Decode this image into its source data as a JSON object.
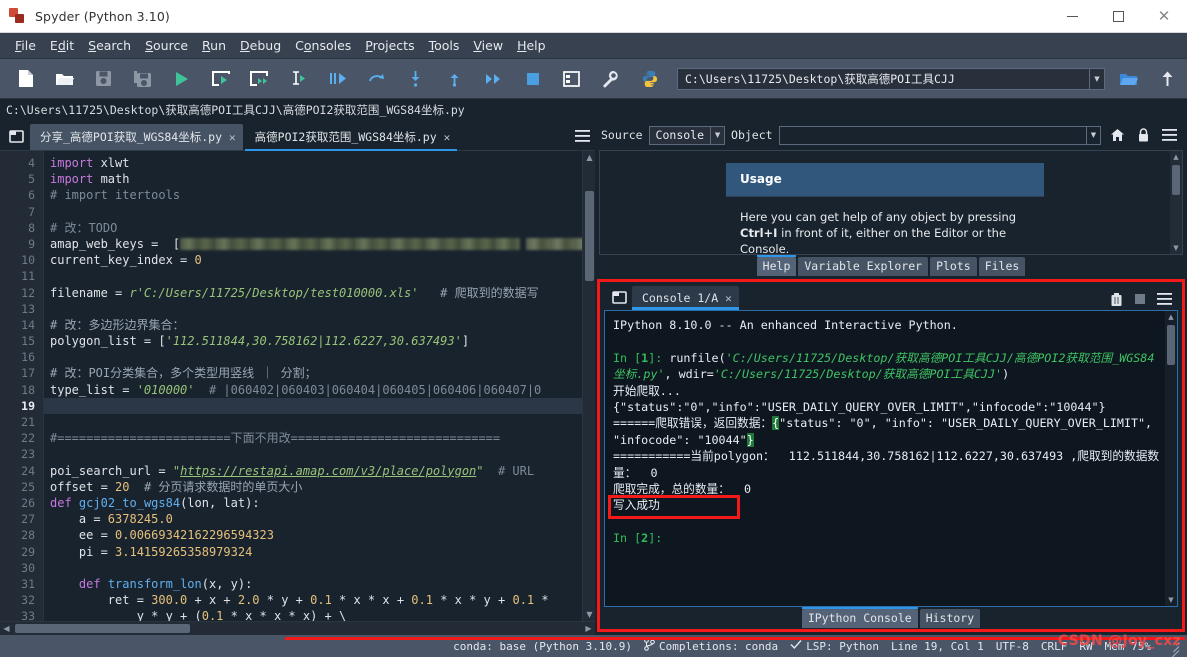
{
  "window": {
    "title": "Spyder (Python 3.10)",
    "minimize": "—",
    "maximize": "□",
    "close": "✕"
  },
  "menubar": {
    "items": [
      "File",
      "Edit",
      "Search",
      "Source",
      "Run",
      "Debug",
      "Consoles",
      "Projects",
      "Tools",
      "View",
      "Help"
    ]
  },
  "toolbar": {
    "icons": [
      "new-file-icon",
      "open-file-icon",
      "save-file-icon",
      "save-all-icon",
      "run-file-icon",
      "run-cell-icon",
      "run-cell-advance-icon",
      "run-selection-icon",
      "debug-file-icon",
      "step-over-icon",
      "step-into-icon",
      "step-return-icon",
      "continue-icon",
      "stop-debug-icon",
      "panes-layout-icon",
      "preferences-icon",
      "python-path-icon"
    ],
    "path_value": "C:\\Users\\11725\\Desktop\\获取高德POI工具CJJ",
    "browse_icon": "folder-open-icon",
    "parent_icon": "arrow-up-icon"
  },
  "editor": {
    "filepath": "C:\\Users\\11725\\Desktop\\获取高德POI工具CJJ\\高德POI2获取范围_WGS84坐标.py",
    "tabs": [
      {
        "label": "分享_高德POI获取_WGS84坐标.py",
        "active": false
      },
      {
        "label": "高德POI2获取范围_WGS84坐标.py",
        "active": true
      }
    ],
    "close_glyph": "✕",
    "options_icon": "hamburger-icon",
    "current_line": 19,
    "first_line": 4,
    "lines": [
      {
        "n": 4,
        "html": "<span class=\"kw\">import</span> xlwt"
      },
      {
        "n": 5,
        "html": "<span class=\"kw\">import</span> math"
      },
      {
        "n": 6,
        "html": "<span class=\"cmt\"># import itertools</span>"
      },
      {
        "n": 7,
        "html": ""
      },
      {
        "n": 8,
        "html": "<span class=\"cmt\"># 改：TODO</span>"
      },
      {
        "n": 9,
        "html": "amap_web_keys = &nbsp;[<span class=\"blurred\"></span><span class=\"blurred2\"></span>"
      },
      {
        "n": 10,
        "html": "current_key_index = <span class=\"num\">0</span>"
      },
      {
        "n": 11,
        "html": ""
      },
      {
        "n": 12,
        "html": "filename = <span class=\"str\">r'C:/Users/11725/Desktop/test010000.xls'</span>&nbsp;&nbsp;&nbsp;<span class=\"cmtu\"># 爬取到的数据写</span>"
      },
      {
        "n": 13,
        "html": ""
      },
      {
        "n": 14,
        "html": "<span class=\"cmtu\"># 改：多边形边界集合：</span>"
      },
      {
        "n": 15,
        "html": "polygon_list = [<span class=\"str\">'112.511844,30.758162|112.6227,30.637493'</span>]"
      },
      {
        "n": 16,
        "html": ""
      },
      {
        "n": 17,
        "html": "<span class=\"cmtu\"># 改：POI分类集合，多个类型用竖线 ｜ 分割；</span>"
      },
      {
        "n": 18,
        "html": "type_list = <span class=\"str\">'010000'</span>&nbsp;&nbsp;<span class=\"cmt\"># |060402|060403|060404|060405|060406|060407|0</span>"
      },
      {
        "n": 19,
        "html": "",
        "highlight": true
      },
      {
        "n": 21,
        "html": ""
      },
      {
        "n": 22,
        "html": "<span class=\"cmt\">#========================下面不用改=============================</span>"
      },
      {
        "n": 23,
        "html": ""
      },
      {
        "n": 24,
        "html": "poi_search_url = <span class=\"str\">\"</span><span class=\"url\">https://restapi.amap.com/v3/place/polygon</span><span class=\"str\">\"</span>&nbsp;&nbsp;<span class=\"cmt\"># URL</span>"
      },
      {
        "n": 25,
        "html": "offset = <span class=\"num\">20</span>&nbsp;&nbsp;<span class=\"cmtu\"># 分页请求数据时的单页大小</span>"
      },
      {
        "n": 26,
        "html": "<span class=\"def\">def</span> <span class=\"fn\">gcj02_to_wgs84</span>(lon, lat):"
      },
      {
        "n": 27,
        "html": "    a = <span class=\"num\">6378245.0</span>"
      },
      {
        "n": 28,
        "html": "    ee = <span class=\"num\">0.00669342162296594323</span>"
      },
      {
        "n": 29,
        "html": "    pi = <span class=\"num\">3.14159265358979324</span>"
      },
      {
        "n": 30,
        "html": ""
      },
      {
        "n": 31,
        "html": "    <span class=\"def\">def</span> <span class=\"fn\">transform_lon</span>(x, y):"
      },
      {
        "n": 32,
        "html": "        ret = <span class=\"num\">300.0</span> + x + <span class=\"num\">2.0</span> * y + <span class=\"num\">0.1</span> * x * x + <span class=\"num\">0.1</span> * x * y + <span class=\"num\">0.1</span> *"
      },
      {
        "n": 33,
        "html": "            y * y + (<span class=\"num\">0.1</span> * x * x * x) + \\"
      }
    ]
  },
  "help_pane": {
    "source_label": "Source",
    "source_value": "Console",
    "object_label": "Object",
    "object_value": "",
    "home_icon": "home-icon",
    "lock_icon": "lock-icon",
    "options_icon": "hamburger-icon",
    "card_title": "Usage",
    "card_body_pre": "Here you can get help of any object by pressing ",
    "card_body_key": "Ctrl+I",
    "card_body_post": " in front of it, either on the Editor or the Console.",
    "tabs": [
      {
        "label": "Help",
        "active": true
      },
      {
        "label": "Variable Explorer",
        "active": false
      },
      {
        "label": "Plots",
        "active": false
      },
      {
        "label": "Files",
        "active": false
      }
    ]
  },
  "console_pane": {
    "pane_icon": "undock-icon",
    "tab_label": "Console 1/A",
    "close_glyph": "✕",
    "trash_icon": "trash-icon",
    "stop-icon": "stop-square-icon",
    "options_icon": "hamburger-icon",
    "lines": [
      {
        "html": "IPython 8.10.0 -- An enhanced Interactive Python."
      },
      {
        "html": ""
      },
      {
        "html": "<span class=\"in\">In [</span><span class=\"inn\">1</span><span class=\"in\">]:</span> runfile(<span class=\"gstr\">'C:/Users/11725/Desktop/获取高德POI工具CJJ/高德POI2获取范围_WGS84坐标.py'</span>, wdir=<span class=\"gstr\">'C:/Users/11725/Desktop/获取高德POI工具CJJ'</span>)"
      },
      {
        "html": "开始爬取..."
      },
      {
        "html": "{\"status\":\"0\",\"info\":\"USER_DAILY_QUERY_OVER_LIMIT\",\"infocode\":\"10044\"}"
      },
      {
        "html": "======爬取错误，返回数据：<span class=\"hlbrace\">{</span>\"status\": \"0\", \"info\": \"USER_DAILY_QUERY_OVER_LIMIT\", \"infocode\": \"10044\"<span class=\"hlbrace\">}</span>"
      },
      {
        "html": "===========当前polygon：&nbsp;&nbsp;112.511844,30.758162|112.6227,30.637493 ,爬取到的数据数量：&nbsp;&nbsp;0"
      },
      {
        "html": "爬取完成，总的数量：&nbsp;&nbsp;0"
      },
      {
        "html": "写入成功"
      },
      {
        "html": ""
      },
      {
        "html": "<span class=\"in\">In [</span><span class=\"inn\">2</span><span class=\"in\">]:</span>"
      }
    ],
    "bottom_tabs": [
      {
        "label": "IPython Console",
        "active": true
      },
      {
        "label": "History",
        "active": false
      }
    ]
  },
  "statusbar": {
    "conda": "conda: base (Python 3.10.9)",
    "branch_icon": "git-branch-icon",
    "completions": "Completions: conda",
    "check_icon": "check-icon",
    "lsp": "LSP: Python",
    "cursor": "Line 19, Col 1",
    "encoding": "UTF-8",
    "eol": "CRLF",
    "rw": "RW",
    "memory": "Mem 75%"
  },
  "annotations": {
    "watermark": "CSDN @Joy_cxz",
    "highlight_color": "#f51a1a"
  }
}
